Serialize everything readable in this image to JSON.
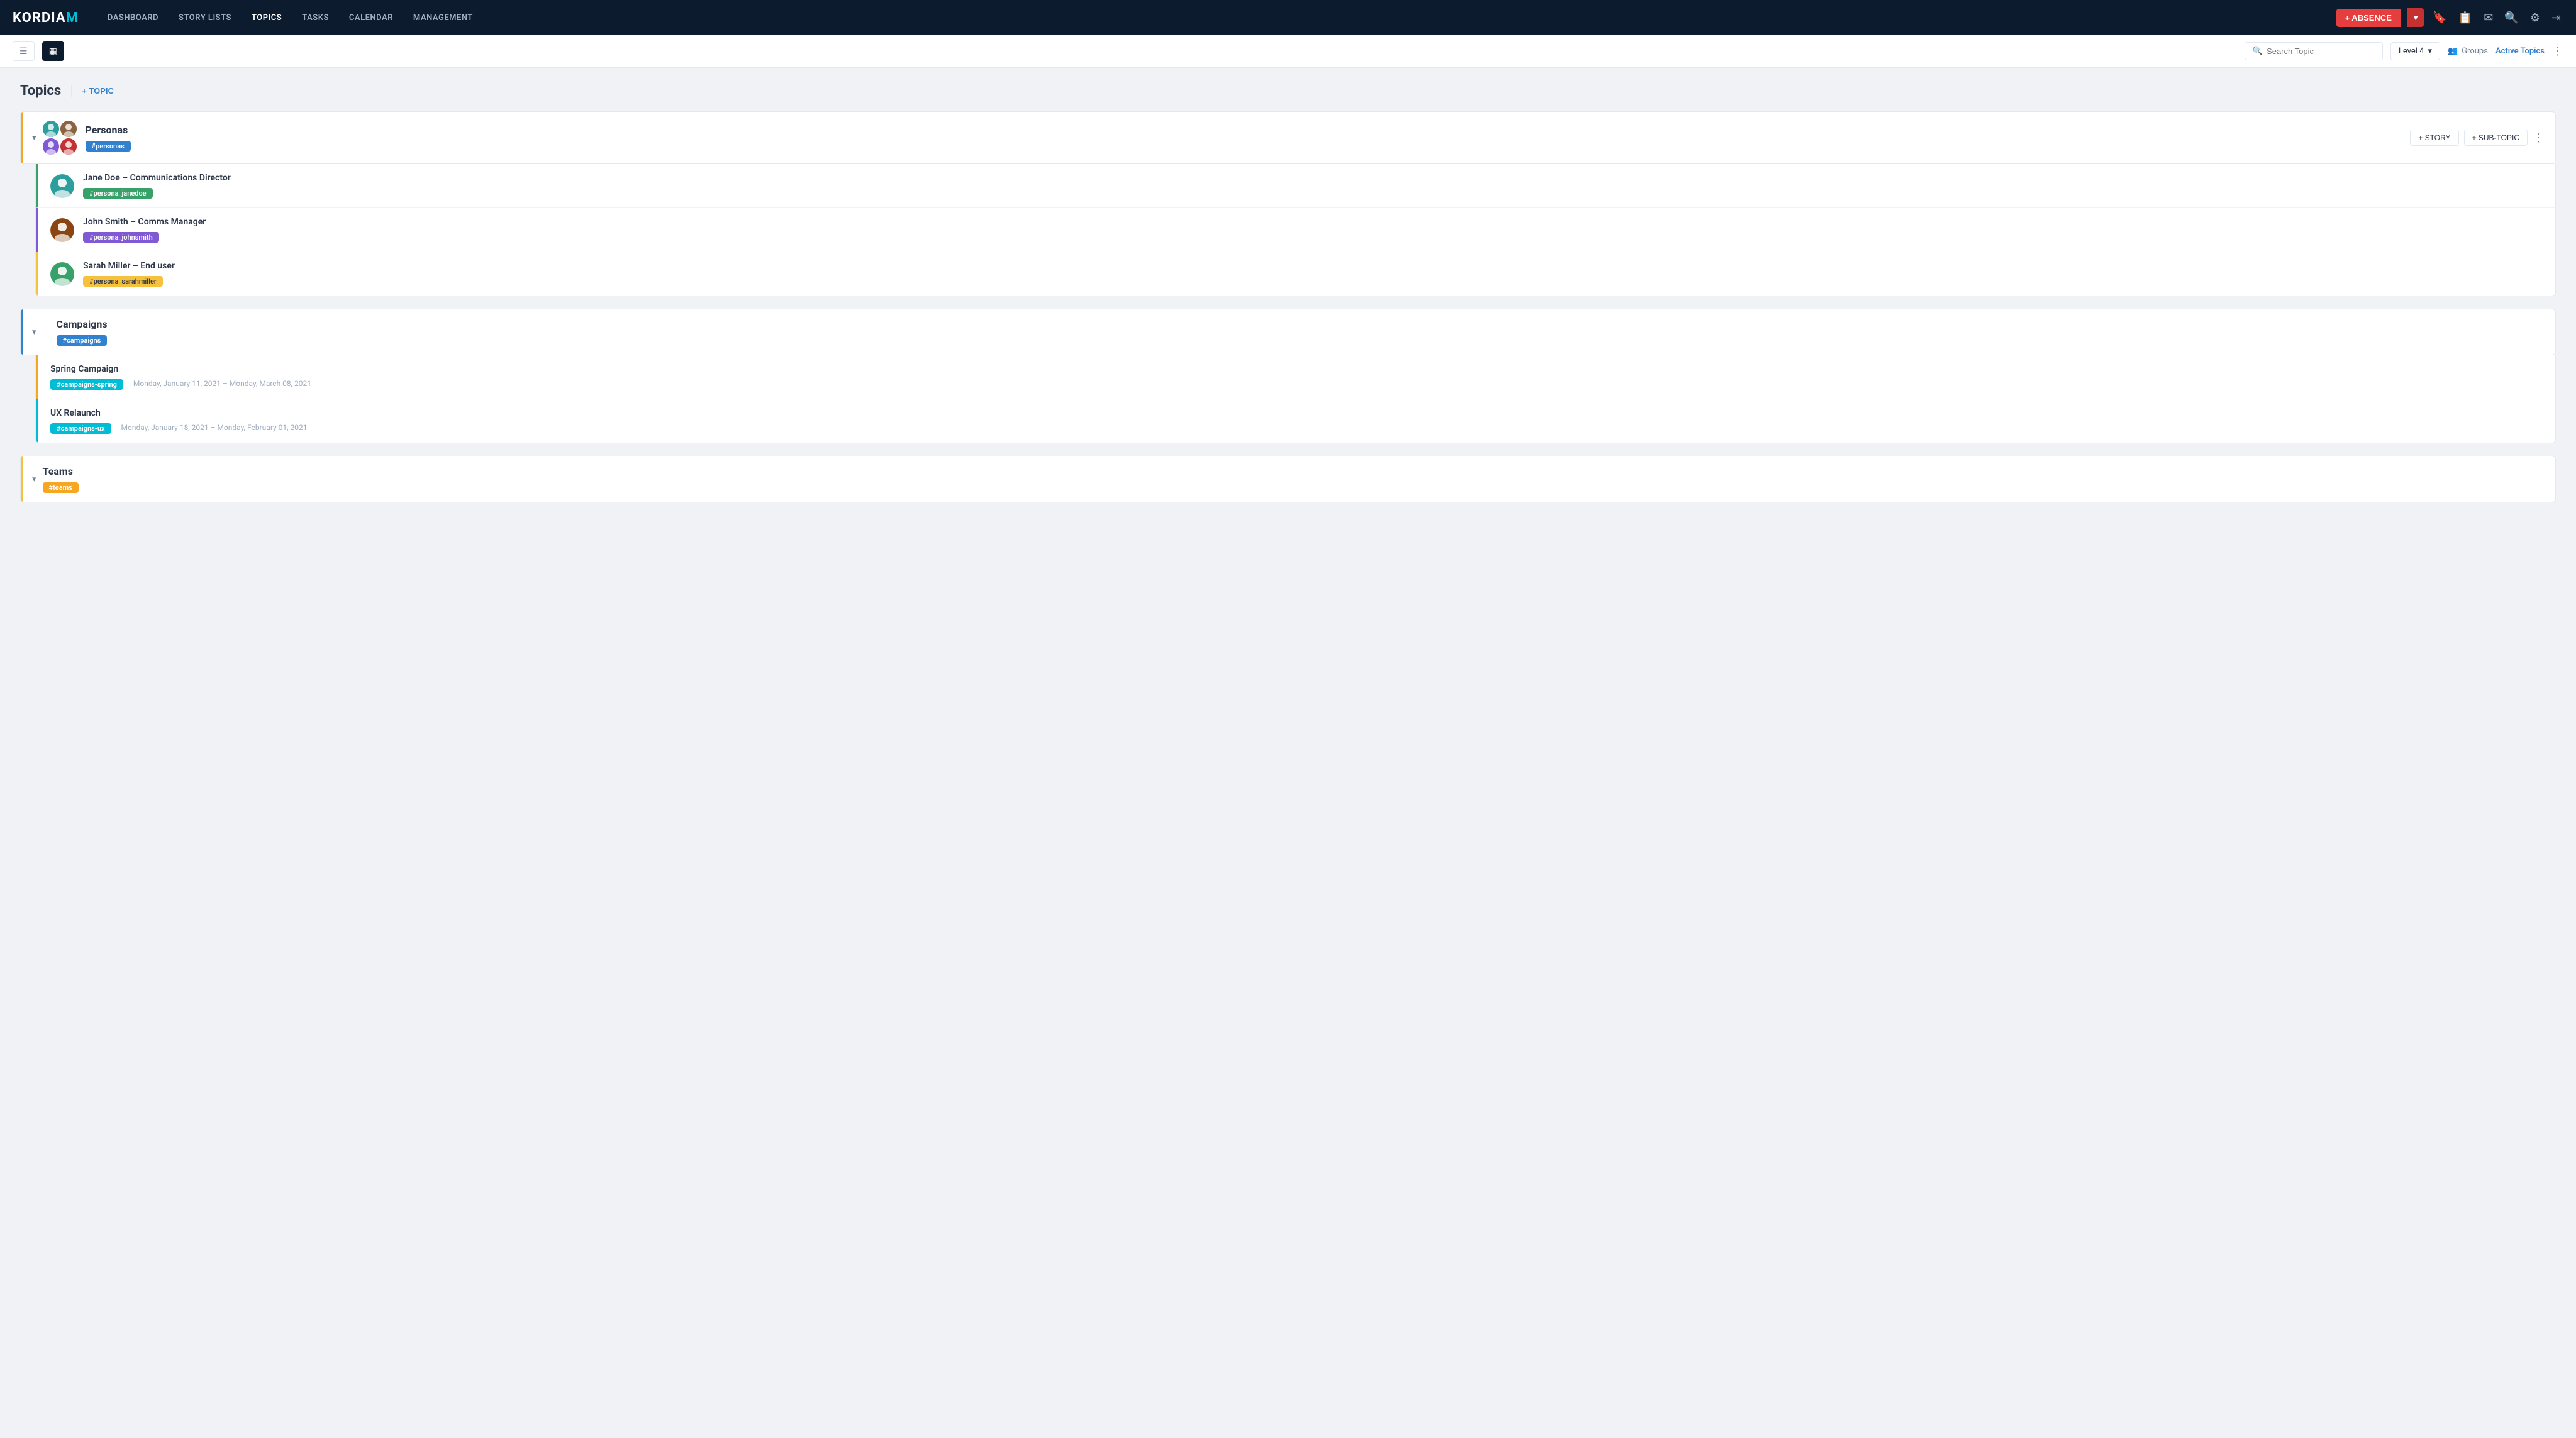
{
  "brand": {
    "name": "KORDIAM",
    "logo_bracket": "M"
  },
  "nav": {
    "links": [
      {
        "id": "dashboard",
        "label": "DASHBOARD",
        "active": false
      },
      {
        "id": "story-lists",
        "label": "STORY LISTS",
        "active": false
      },
      {
        "id": "topics",
        "label": "TOPICS",
        "active": true
      },
      {
        "id": "tasks",
        "label": "TASKS",
        "active": false
      },
      {
        "id": "calendar",
        "label": "CALENDAR",
        "active": false
      },
      {
        "id": "management",
        "label": "MANAGEMENT",
        "active": false
      }
    ],
    "absence_btn": "+ ABSENCE",
    "icons": [
      "bookmark",
      "clipboard",
      "mail",
      "search",
      "settings",
      "signout"
    ]
  },
  "toolbar": {
    "search_placeholder": "Search Topic",
    "level_label": "Level 4",
    "groups_label": "Groups",
    "active_topics_label": "Active Topics"
  },
  "page": {
    "title": "Topics",
    "add_topic_label": "+ TOPIC"
  },
  "topics": [
    {
      "id": "personas",
      "name": "Personas",
      "tag": "#personas",
      "tag_color": "tag-blue",
      "bar_color": "bar-orange",
      "story_btn": "+ STORY",
      "subtopic_btn": "+ SUB-TOPIC",
      "subtopics": [
        {
          "id": "jane-doe",
          "name": "Jane Doe – Communications Director",
          "tag": "#persona_janedoe",
          "tag_color": "tag-green",
          "border_color": "border-green"
        },
        {
          "id": "john-smith",
          "name": "John Smith – Comms Manager",
          "tag": "#persona_johnsmith",
          "tag_color": "tag-purple",
          "border_color": "border-purple"
        },
        {
          "id": "sarah-miller",
          "name": "Sarah Miller – End user",
          "tag": "#persona_sarahmiller",
          "tag_color": "tag-yellow",
          "border_color": "border-yellow"
        }
      ]
    },
    {
      "id": "campaigns",
      "name": "Campaigns",
      "tag": "#campaigns",
      "tag_color": "tag-blue",
      "bar_color": "bar-blue",
      "subtopics": [
        {
          "id": "spring-campaign",
          "name": "Spring Campaign",
          "tag": "#campaigns-spring",
          "tag_color": "tag-cyan",
          "date": "Monday, January 11, 2021 – Monday, March 08, 2021",
          "border_color": "border-orange"
        },
        {
          "id": "ux-relaunch",
          "name": "UX Relaunch",
          "tag": "#campaigns-ux",
          "tag_color": "tag-cyan",
          "date": "Monday, January 18, 2021 – Monday, February 01, 2021",
          "border_color": "border-cyan"
        }
      ]
    },
    {
      "id": "teams",
      "name": "Teams",
      "tag": "#teams",
      "tag_color": "tag-orange",
      "bar_color": "bar-yellow",
      "subtopics": []
    }
  ]
}
